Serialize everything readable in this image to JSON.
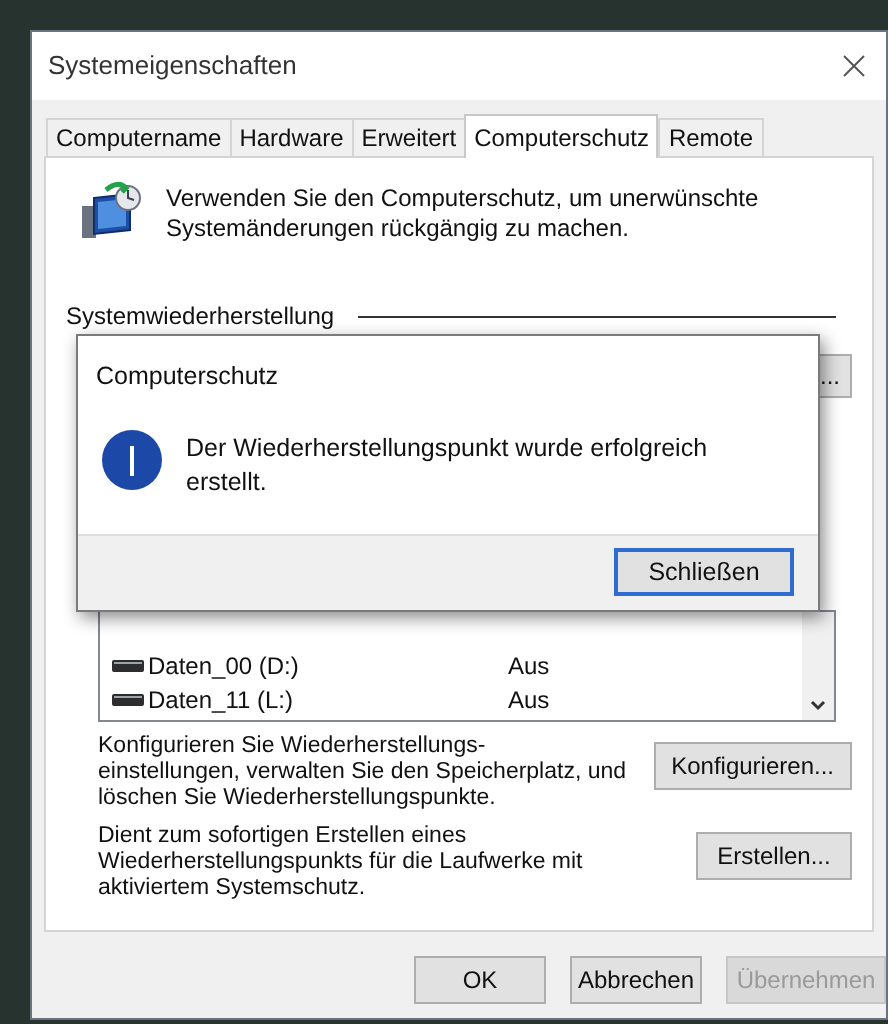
{
  "window": {
    "title": "Systemeigenschaften"
  },
  "tabs": [
    {
      "label": "Computername",
      "selected": false
    },
    {
      "label": "Hardware",
      "selected": false
    },
    {
      "label": "Erweitert",
      "selected": false
    },
    {
      "label": "Computerschutz",
      "selected": true
    },
    {
      "label": "Remote",
      "selected": false
    }
  ],
  "intro": "Verwenden Sie den Computerschutz, um unerwünschte\nSystemänderungen rückgängig zu machen.",
  "section_title": "Systemwiederherstellung",
  "covered_button": "...",
  "drives": [
    {
      "name": "Daten_00 (D:)",
      "protection": "Aus"
    },
    {
      "name": "Daten_11 (L:)",
      "protection": "Aus"
    }
  ],
  "actions": [
    {
      "text": "Konfigurieren Sie Wiederherstellungs-\neinstellungen, verwalten Sie den Speicherplatz, und\nlöschen Sie Wiederherstellungspunkte.",
      "button": "Konfigurieren..."
    },
    {
      "text": "Dient zum sofortigen Erstellen eines\nWiederherstellungspunkts für die Laufwerke mit\naktiviertem Systemschutz.",
      "button": "Erstellen..."
    }
  ],
  "buttons": [
    {
      "label": "OK",
      "disabled": false
    },
    {
      "label": "Abbrechen",
      "disabled": false
    },
    {
      "label": "Übernehmen",
      "disabled": true
    }
  ],
  "dialog": {
    "title": "Computerschutz",
    "message": "Der Wiederherstellungspunkt wurde erfolgreich\nerstellt.",
    "button": "Schließen"
  }
}
